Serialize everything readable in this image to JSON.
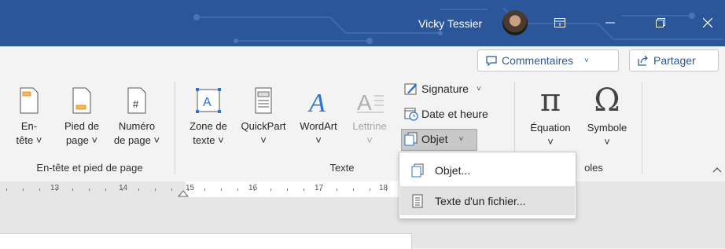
{
  "titlebar": {
    "user_name": "Vicky Tessier",
    "bg_color": "#2b579a"
  },
  "window_controls": [
    "ribbon-display-options-icon",
    "minimize-icon",
    "restore-icon",
    "close-icon"
  ],
  "header_actions": {
    "comments_label": "Commentaires",
    "share_label": "Partager"
  },
  "groups": {
    "header_footer": {
      "label": "En-tête et pied de page",
      "items": [
        {
          "line1": "En-",
          "line2": "tête ˅"
        },
        {
          "line1": "Pied de",
          "line2": "page ˅"
        },
        {
          "line1": "Numéro",
          "line2": "de page ˅"
        }
      ]
    },
    "text": {
      "label": "Texte",
      "items": [
        {
          "line1": "Zone de",
          "line2": "texte ˅"
        },
        {
          "line1": "QuickPart",
          "line2": "˅"
        },
        {
          "line1": "WordArt",
          "line2": "˅"
        },
        {
          "line1": "Lettrine",
          "line2": "˅"
        }
      ],
      "signature": "Signature",
      "datetime": "Date et heure",
      "object": "Objet"
    },
    "symbols": {
      "label": "oles",
      "items": [
        {
          "line1": "Équation",
          "line2": "˅",
          "glyph": "π"
        },
        {
          "line1": "Symbole",
          "line2": "˅",
          "glyph": "Ω"
        }
      ]
    }
  },
  "dropdown": {
    "items": [
      {
        "label": "Objet..."
      },
      {
        "label": "Texte d'un fichier..."
      }
    ]
  },
  "ruler": {
    "numbers": [
      "13",
      "14",
      "15",
      "16",
      "17",
      "18"
    ]
  }
}
